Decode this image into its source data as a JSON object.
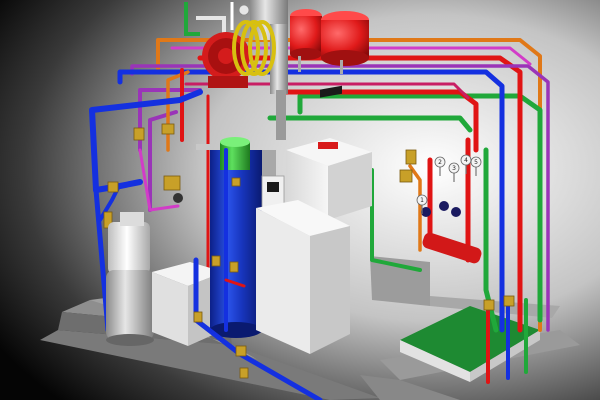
{
  "scene": {
    "pipe_colors": {
      "cold_water": "#1430e0",
      "hot_supply": "#e01414",
      "heating_return": "#20a83a",
      "circulation": "#e07818",
      "solar_loop": "#9a34b8",
      "recirculation": "#d23cc8",
      "domestic_return": "#c81e64"
    },
    "component_colors": {
      "storage_tank": "#1a3ccc",
      "tank_cap": "#3ec23e",
      "expansion_vessel": "#e01a1a",
      "hose_reel": "#d41c1c",
      "floor_plinth": "#9e9e9e",
      "boiler_casing": "#ececec",
      "manifold": "#d21818",
      "drain_pad": "#1e8a32"
    },
    "gauges": [
      {
        "id": "gauge-1",
        "label": "1"
      },
      {
        "id": "gauge-2",
        "label": "2"
      },
      {
        "id": "gauge-3",
        "label": "3"
      },
      {
        "id": "gauge-4",
        "label": "4"
      },
      {
        "id": "gauge-5",
        "label": "5"
      }
    ]
  }
}
